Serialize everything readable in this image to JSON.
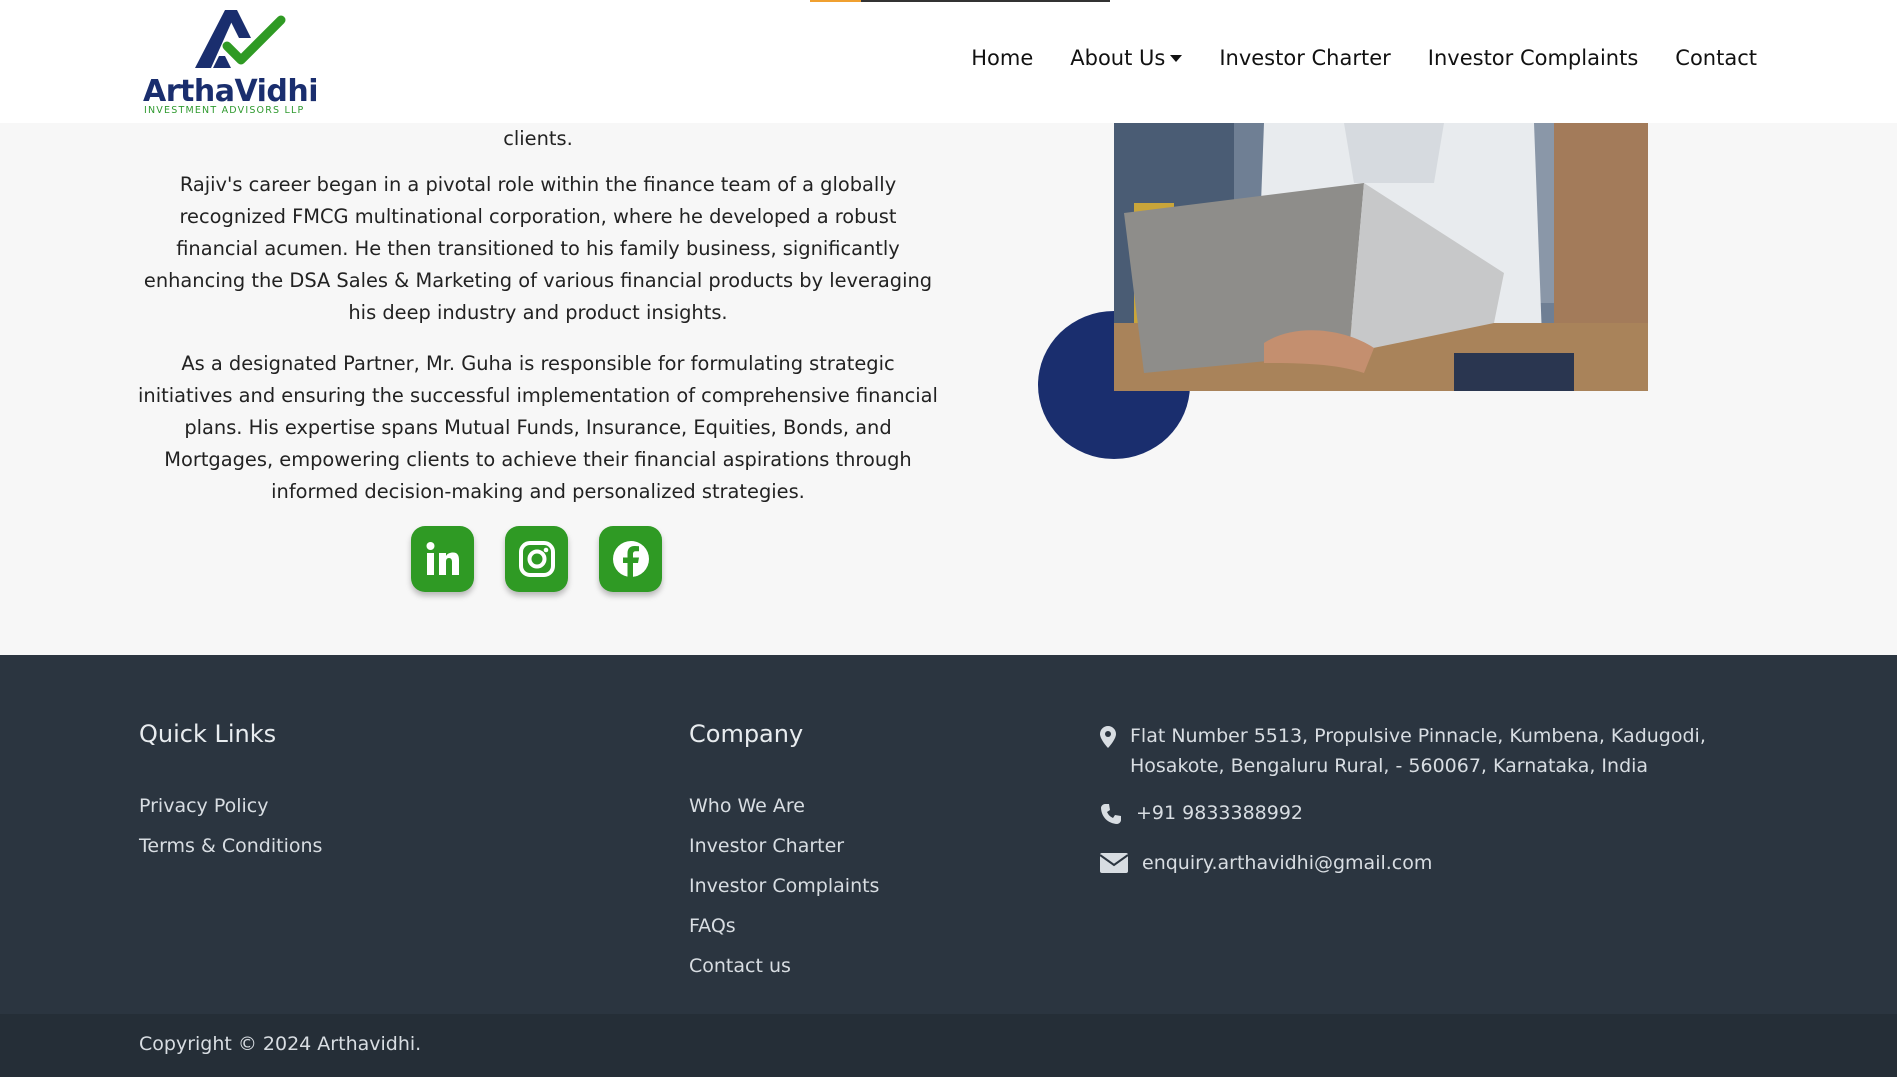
{
  "header": {
    "logo": {
      "name": "ArthaVidhi",
      "subtitle": "INVESTMENT ADVISORS LLP"
    },
    "progress": 0.17,
    "nav": [
      {
        "label": "Home"
      },
      {
        "label": "About Us",
        "dropdown": true
      },
      {
        "label": "Investor Charter"
      },
      {
        "label": "Investor Complaints"
      },
      {
        "label": "Contact"
      }
    ]
  },
  "main": {
    "paragraphs": [
      "clients.",
      "Rajiv's career began in a pivotal role within the finance team of a globally recognized FMCG multinational corporation, where he developed a robust financial acumen. He then transitioned to his family business, significantly enhancing the DSA Sales & Marketing of various financial products by leveraging his deep industry and product insights.",
      "As a designated Partner, Mr. Guha is responsible for formulating strategic initiatives and ensuring the successful implementation of comprehensive financial plans. His expertise spans Mutual Funds, Insurance, Equities, Bonds, and Mortgages, empowering clients to achieve their financial aspirations through informed decision-making and personalized strategies."
    ],
    "socials": [
      "linkedin-icon",
      "instagram-icon",
      "facebook-icon"
    ]
  },
  "footer": {
    "quick_links": {
      "title": "Quick Links",
      "links": [
        "Privacy Policy",
        "Terms & Conditions"
      ]
    },
    "company": {
      "title": "Company",
      "links": [
        "Who We Are",
        "Investor Charter",
        "Investor Complaints",
        "FAQs",
        "Contact us"
      ]
    },
    "contact": {
      "address_line1": "Flat Number 5513, Propulsive Pinnacle, Kumbena, Kadugodi,",
      "address_line2": "Hosakote, Bengaluru Rural, - 560067, Karnataka, India",
      "phone": "+91 9833388992",
      "email": "enquiry.arthavidhi@gmail.com"
    },
    "copyright": "Copyright © 2024 Arthavidhi."
  },
  "colors": {
    "brand_navy": "#1a2e6e",
    "brand_green": "#2f9a24",
    "footer_bg": "#2b3540",
    "footer_bottom_bg": "#252e37"
  }
}
